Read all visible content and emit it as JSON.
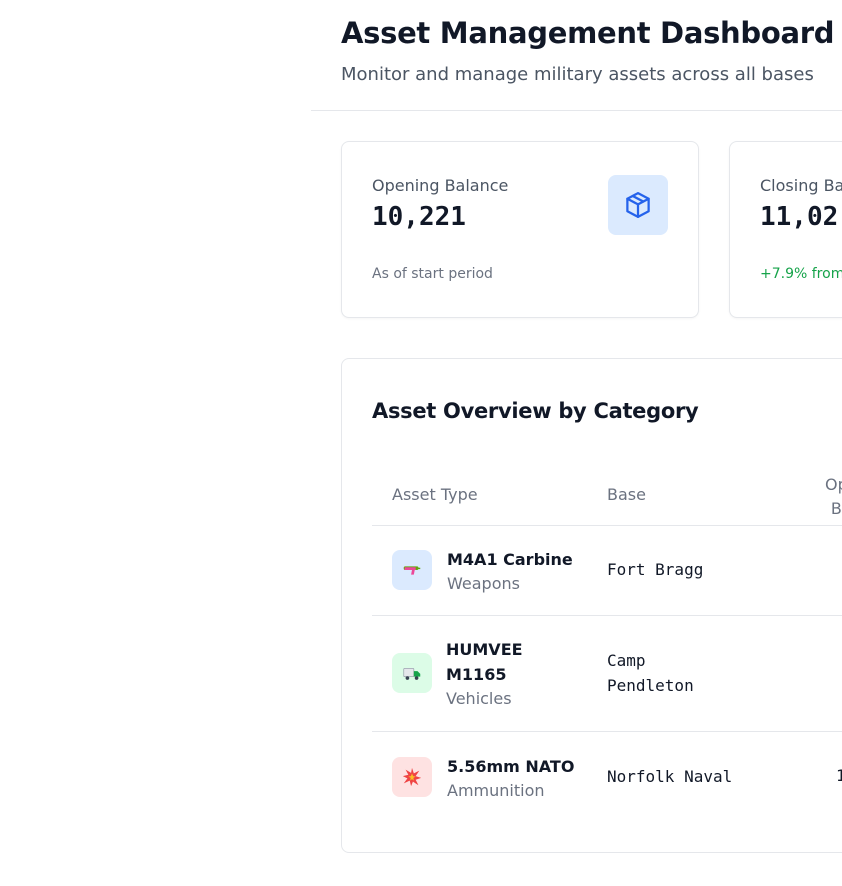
{
  "header": {
    "title": "Asset Management Dashboard",
    "subtitle": "Monitor and manage military assets across all bases"
  },
  "cards": [
    {
      "label": "Opening Balance",
      "value": "10,221",
      "note": "As of start period",
      "icon": "cube-icon",
      "icon_color": "#2563eb",
      "icon_bg": "#dbeafe"
    },
    {
      "label": "Closing Ba",
      "value": "11,02",
      "note": "+7.9% from",
      "note_color": "#16a34a"
    }
  ],
  "overview": {
    "title": "Asset Overview by Category",
    "columns": {
      "asset_type": "Asset Type",
      "base": "Base",
      "opening_line1": "Op",
      "opening_line2": "B"
    },
    "rows": [
      {
        "name": "M4A1 Carbine",
        "category": "Weapons",
        "base": "Fort Bragg",
        "opening": "",
        "icon": "gun-icon",
        "icon_bg": "#dbeafe"
      },
      {
        "name_line1": "HUMVEE",
        "name_line2": "M1165",
        "category": "Vehicles",
        "base_line1": "Camp",
        "base_line2": "Pendleton",
        "opening": "",
        "icon": "truck-icon",
        "icon_bg": "#dcfce7"
      },
      {
        "name": "5.56mm NATO",
        "category": "Ammunition",
        "base": "Norfolk Naval",
        "opening": "1",
        "icon": "explosion-icon",
        "icon_bg": "#fee2e2"
      }
    ]
  }
}
